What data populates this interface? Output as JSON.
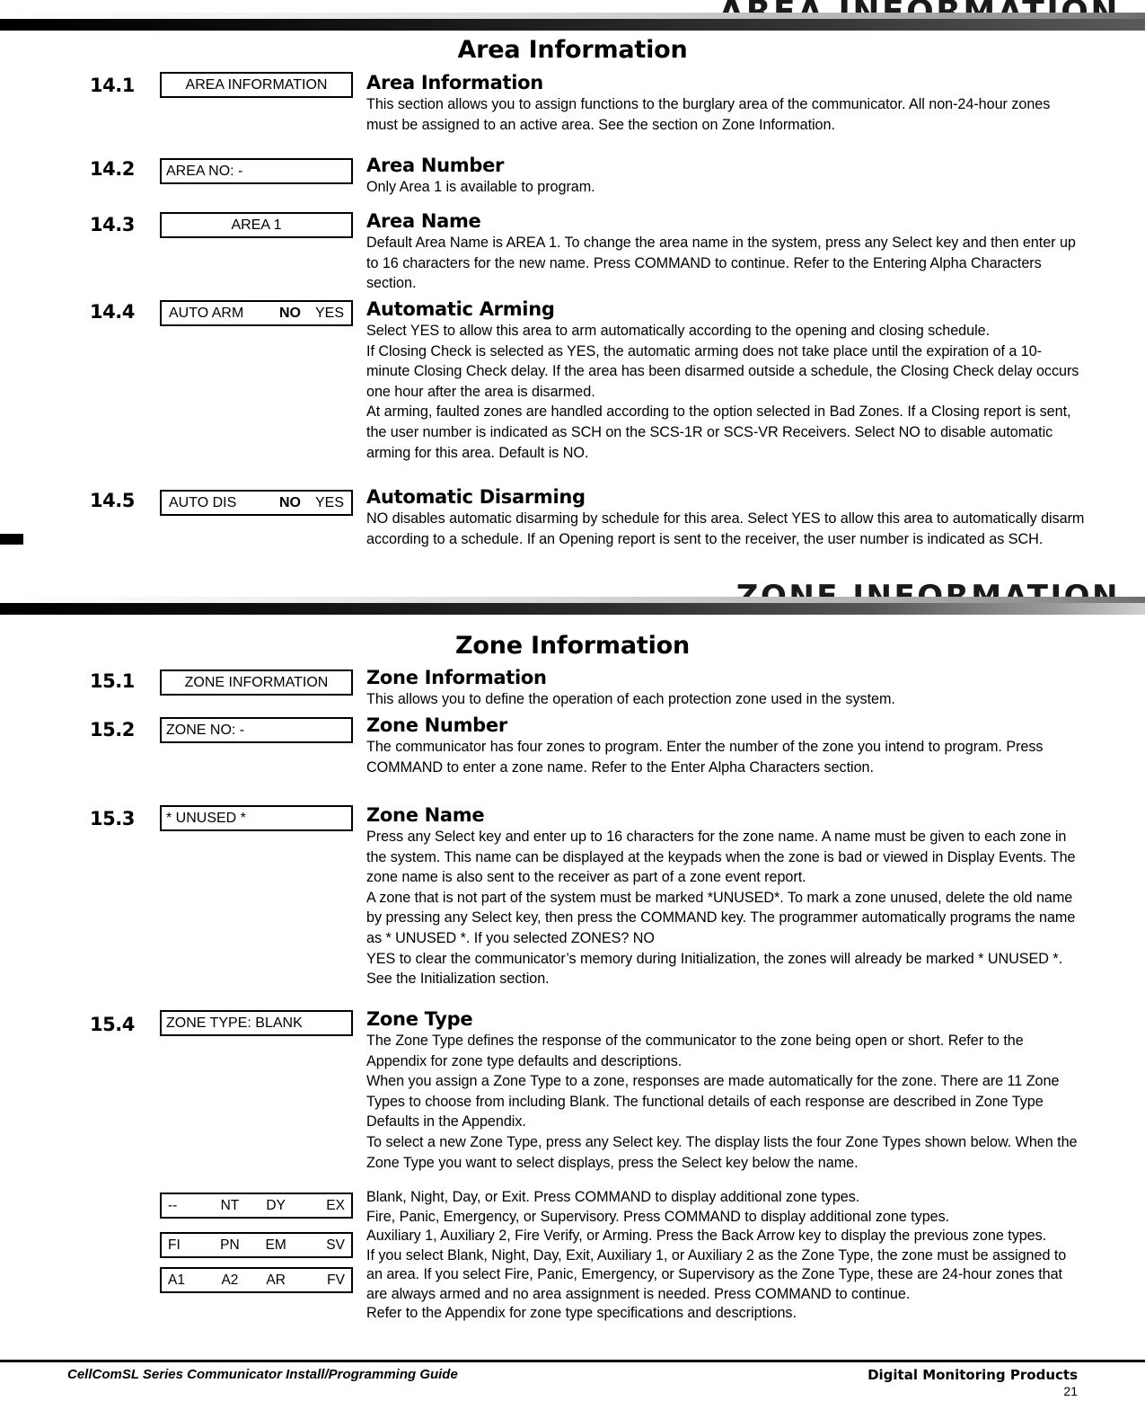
{
  "page": {
    "number": "21",
    "footer_left": "CellComSL Series Communicator Install/Programming Guide",
    "footer_right": "Digital Monitoring Products"
  },
  "header_bands": [
    {
      "title": "AREA INFORMATION"
    },
    {
      "title": "ZONE INFORMATION"
    }
  ],
  "sections": [
    {
      "title": "Area Information",
      "entries": [
        {
          "num": "14.1",
          "lcd": "AREA INFORMATION",
          "lcd_align": "center",
          "heading": "Area Information",
          "paragraphs": [
            "This section allows you to assign functions to the burglary area of the communicator. All non-24-hour zones must be assigned to an active area. See the section on Zone Information."
          ]
        },
        {
          "num": "14.2",
          "lcd": "AREA NO: -",
          "lcd_align": "left",
          "heading": "Area Number",
          "paragraphs": [
            "Only Area 1 is available to program."
          ]
        },
        {
          "num": "14.3",
          "lcd": "AREA 1",
          "lcd_align": "center",
          "heading": "Area Name",
          "paragraphs": [
            "Default Area Name is AREA 1. To change the area name in the system, press any Select key and then enter up to 16 characters for the new name. Press COMMAND to continue. Refer to the Entering Alpha Characters section."
          ]
        },
        {
          "num": "14.4",
          "lcd_option": {
            "label": "AUTO ARM",
            "selected": "NO",
            "other": "YES"
          },
          "heading": "Automatic Arming",
          "paragraphs": [
            "Select YES to allow this area to arm automatically according to the opening and closing schedule.",
            "If Closing Check is selected as YES, the automatic arming does not take place until the expiration of a 10-minute Closing Check delay. If the area has been disarmed outside a schedule, the Closing Check delay occurs one hour after the area is disarmed.",
            "At arming, faulted zones are handled according to the option selected in Bad Zones. If a Closing report is sent, the user number is indicated as SCH on the SCS-1R or SCS-VR Receivers. Select NO to disable automatic arming for this area. Default is NO."
          ]
        },
        {
          "num": "14.5",
          "lcd_option": {
            "label": "AUTO DIS",
            "selected": "NO",
            "other": "YES"
          },
          "heading": "Automatic Disarming",
          "paragraphs": [
            "NO disables automatic disarming by schedule for this area. Select YES to allow this area to automatically disarm according to a schedule. If an Opening report is sent to the receiver, the user number is indicated as SCH."
          ]
        }
      ]
    },
    {
      "title": "Zone Information",
      "entries": [
        {
          "num": "15.1",
          "lcd": "ZONE INFORMATION",
          "lcd_align": "center",
          "heading": "Zone Information",
          "paragraphs": [
            "This allows you to define the operation of each protection zone used in the system."
          ]
        },
        {
          "num": "15.2",
          "lcd": "ZONE NO: -",
          "lcd_align": "left",
          "heading": "Zone Number",
          "paragraphs": [
            "The communicator has four zones to program. Enter the number of the zone you intend to program. Press COMMAND to enter a zone name. Refer to the Enter Alpha Characters section."
          ]
        },
        {
          "num": "15.3",
          "lcd": "* UNUSED *",
          "lcd_align": "left",
          "heading": "Zone Name",
          "paragraphs": [
            "Press any Select key and enter up to 16 characters for the zone name. A name must be given to each zone in the system. This name can be displayed at the keypads when the zone is bad or viewed in Display Events. The zone name is also sent to the receiver as part of a zone event report.",
            "A zone that is not part of the system must be marked *UNUSED*. To mark a zone unused, delete the old name by pressing any Select key, then press the COMMAND key. The programmer automatically programs the name as * UNUSED *. If you selected ZONES? NO",
            "YES to clear the communicator’s memory during Initialization, the zones will already be marked * UNUSED *. See the Initialization section."
          ]
        },
        {
          "num": "15.4",
          "lcd": "ZONE TYPE: BLANK",
          "lcd_align": "left",
          "heading": "Zone Type",
          "paragraphs": [
            "The Zone Type defines the response of the communicator to the zone being open or short. Refer to the Appendix for zone type defaults and descriptions.",
            "When you assign a Zone Type to a zone, responses are made automatically for the zone. There are 11 Zone Types to choose from including Blank. The functional details of each response are described in Zone Type Defaults in the Appendix.",
            "To select a new Zone Type, press any Select key. The display lists the four Zone Types shown below. When the Zone Type you want to select displays, press the Select key below the name."
          ]
        }
      ]
    }
  ],
  "zone_type_table": {
    "rows": [
      {
        "cells": [
          "--",
          "NT",
          "DY",
          "EX"
        ]
      },
      {
        "cells": [
          "FI",
          "PN",
          "EM",
          "SV"
        ]
      },
      {
        "cells": [
          "A1",
          "A2",
          "AR",
          "FV"
        ]
      }
    ],
    "notes": [
      "Blank, Night, Day, or Exit. Press COMMAND to display additional zone types.",
      "Fire, Panic, Emergency, or Supervisory. Press COMMAND to display additional zone types.",
      "Auxiliary 1, Auxiliary 2, Fire Verify, or Arming. Press the Back Arrow key to display the previous zone types.",
      "If you select Blank, Night, Day, Exit, Auxiliary 1, or Auxiliary 2 as the Zone Type, the zone must be assigned to an area. If you select Fire, Panic, Emergency, or Supervisory as the Zone Type, these are 24-hour zones that are always armed and no area assignment is needed. Press COMMAND to continue.",
      "Refer to the Appendix for zone type specifications and descriptions."
    ]
  }
}
